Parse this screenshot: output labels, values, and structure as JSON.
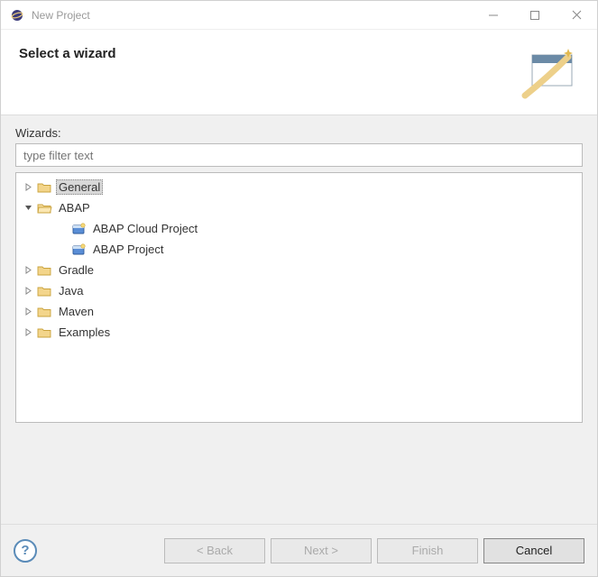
{
  "window": {
    "title": "New Project"
  },
  "header": {
    "heading": "Select a wizard"
  },
  "content": {
    "wizards_label": "Wizards:",
    "filter_placeholder": "type filter text"
  },
  "tree": [
    {
      "label": "General",
      "expanded": false,
      "type": "folder",
      "selected": true,
      "level": 0
    },
    {
      "label": "ABAP",
      "expanded": true,
      "type": "folder-open",
      "selected": false,
      "level": 0
    },
    {
      "label": "ABAP Cloud Project",
      "type": "project",
      "selected": false,
      "level": 1
    },
    {
      "label": "ABAP Project",
      "type": "project",
      "selected": false,
      "level": 1
    },
    {
      "label": "Gradle",
      "expanded": false,
      "type": "folder",
      "selected": false,
      "level": 0
    },
    {
      "label": "Java",
      "expanded": false,
      "type": "folder",
      "selected": false,
      "level": 0
    },
    {
      "label": "Maven",
      "expanded": false,
      "type": "folder",
      "selected": false,
      "level": 0
    },
    {
      "label": "Examples",
      "expanded": false,
      "type": "folder",
      "selected": false,
      "level": 0
    }
  ],
  "buttons": {
    "back": "< Back",
    "next": "Next >",
    "finish": "Finish",
    "cancel": "Cancel"
  }
}
